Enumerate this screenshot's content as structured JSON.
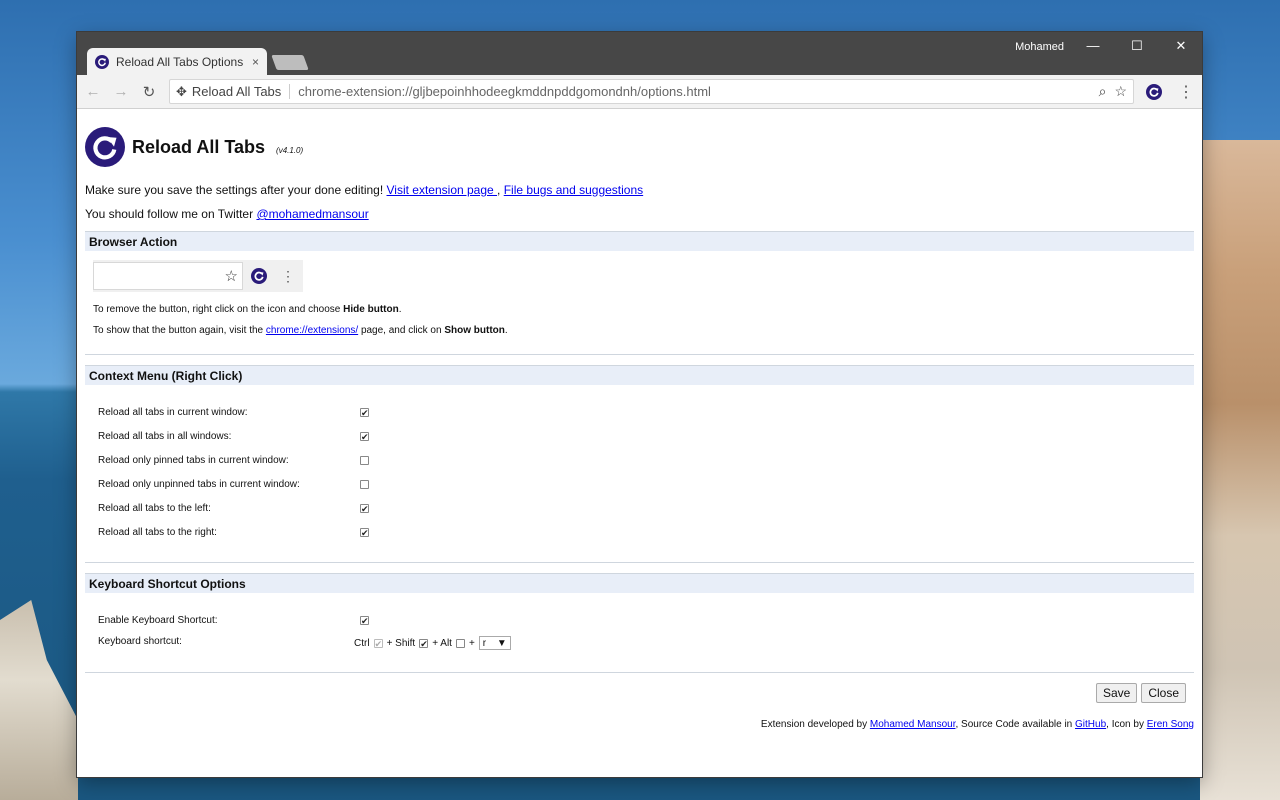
{
  "window": {
    "tab_title": "Reload All Tabs Options",
    "tab_close": "×",
    "user": "Mohamed",
    "controls": {
      "minimize": "—",
      "maximize": "☐",
      "close": "✕"
    }
  },
  "toolbar": {
    "site_label": "Reload All Tabs",
    "url": "chrome-extension://gljbepoinhhodeegkmddnpddgomondnh/options.html"
  },
  "header": {
    "title": "Reload All Tabs",
    "version": "(v4.1.0)"
  },
  "intro": {
    "text": "Make sure you save the settings after your done editing!",
    "link1": "Visit extension page ",
    "separator": " , ",
    "link2": "File bugs and suggestions ",
    "twitter_text": "You should follow me on Twitter",
    "twitter_link": "@mohamedmansour"
  },
  "browser_action": {
    "title": "Browser Action",
    "remove_text_1": "To remove the button, right click on the icon and choose",
    "remove_bold": "Hide button",
    "show_text_1": "To show that the button again, visit the",
    "show_link": "chrome://extensions/",
    "show_text_2": "page, and click on",
    "show_bold": "Show button"
  },
  "context_menu": {
    "title": "Context Menu (Right Click)",
    "options": [
      {
        "label": "Reload all tabs in current window:",
        "checked": true
      },
      {
        "label": "Reload all tabs in all windows:",
        "checked": true
      },
      {
        "label": "Reload only pinned tabs in current window:",
        "checked": false
      },
      {
        "label": "Reload only unpinned tabs in current window:",
        "checked": false
      },
      {
        "label": "Reload all tabs to the left:",
        "checked": true
      },
      {
        "label": "Reload all tabs to the right:",
        "checked": true
      }
    ]
  },
  "keyboard": {
    "title": "Keyboard Shortcut Options",
    "enable_label": "Enable Keyboard Shortcut:",
    "enable_checked": true,
    "shortcut_label": "Keyboard shortcut:",
    "ctrl": "Ctrl",
    "shift": "+ Shift",
    "alt": "+ Alt",
    "plus": "+",
    "key": "r"
  },
  "actions": {
    "save": "Save",
    "close": "Close"
  },
  "footer": {
    "t1": "Extension developed by",
    "author": "Mohamed Mansour",
    "t2": ", Source Code available in",
    "github": "GitHub",
    "t3": ", Icon by",
    "icon_author": "Eren Song"
  }
}
